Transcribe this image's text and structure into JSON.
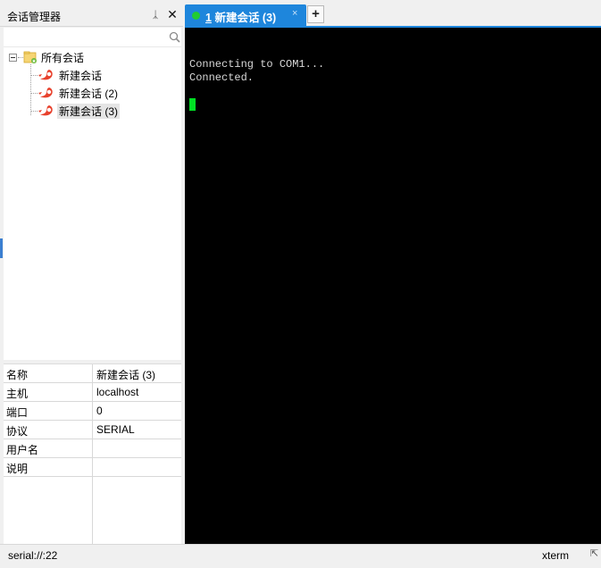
{
  "session_manager": {
    "title": "会话管理器",
    "pin_glyph": "ᛣ",
    "close_glyph": "✕",
    "search": {
      "placeholder": "",
      "value": ""
    },
    "tree": {
      "root_label": "所有会话",
      "items": [
        {
          "label": "新建会话",
          "selected": false
        },
        {
          "label": "新建会话 (2)",
          "selected": false
        },
        {
          "label": "新建会话 (3)",
          "selected": true
        }
      ]
    },
    "properties": [
      {
        "key": "名称",
        "value": "新建会话 (3)"
      },
      {
        "key": "主机",
        "value": "localhost"
      },
      {
        "key": "端口",
        "value": "0"
      },
      {
        "key": "协议",
        "value": "SERIAL"
      },
      {
        "key": "用户名",
        "value": ""
      },
      {
        "key": "说明",
        "value": ""
      }
    ]
  },
  "tabs": {
    "active": {
      "number": "1",
      "label": "新建会话 (3)",
      "close_glyph": "×",
      "status_color": "#22cc33"
    },
    "add_glyph": "+"
  },
  "terminal": {
    "lines": [
      "Connecting to COM1...",
      "Connected."
    ],
    "cursor_color": "#00e024"
  },
  "status_bar": {
    "connection": "serial://:22",
    "terminal_type": "xterm",
    "resize_glyph": "⇱"
  },
  "colors": {
    "accent": "#1e86dc",
    "terminal_bg": "#000000",
    "session_icon": "#e8412c"
  }
}
